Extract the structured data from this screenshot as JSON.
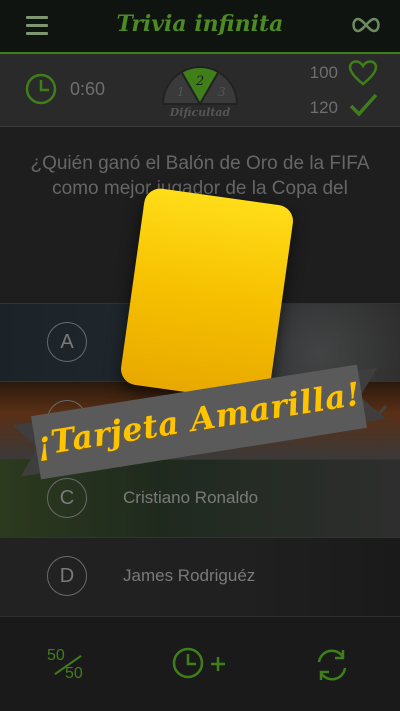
{
  "header": {
    "title": "Trivia infinita"
  },
  "status": {
    "timer": "0:60",
    "difficulty_levels": [
      "1",
      "2",
      "3"
    ],
    "difficulty_label": "Dificultad",
    "score": "100",
    "correct": "120"
  },
  "question": {
    "text": "¿Quién ganó el Balón de Oro de la FIFA como mejor jugador de la Copa del Mundo 2014?"
  },
  "answers": [
    {
      "letter": "A",
      "text": ""
    },
    {
      "letter": "B",
      "text": ""
    },
    {
      "letter": "C",
      "text": "Cristiano Ronaldo"
    },
    {
      "letter": "D",
      "text": "James Rodriguéz"
    }
  ],
  "lifelines": {
    "fifty_top": "50",
    "fifty_bottom": "50"
  },
  "overlay": {
    "banner_text": "¡Tarjeta Amarilla!"
  },
  "colors": {
    "accent": "#3f7f1a",
    "card": "#f6c000",
    "banner": "#5a5a5a"
  },
  "icons": [
    "menu-icon",
    "infinity-icon",
    "clock-icon",
    "heart-icon",
    "check-icon",
    "clock-plus-icon",
    "swap-icon"
  ]
}
